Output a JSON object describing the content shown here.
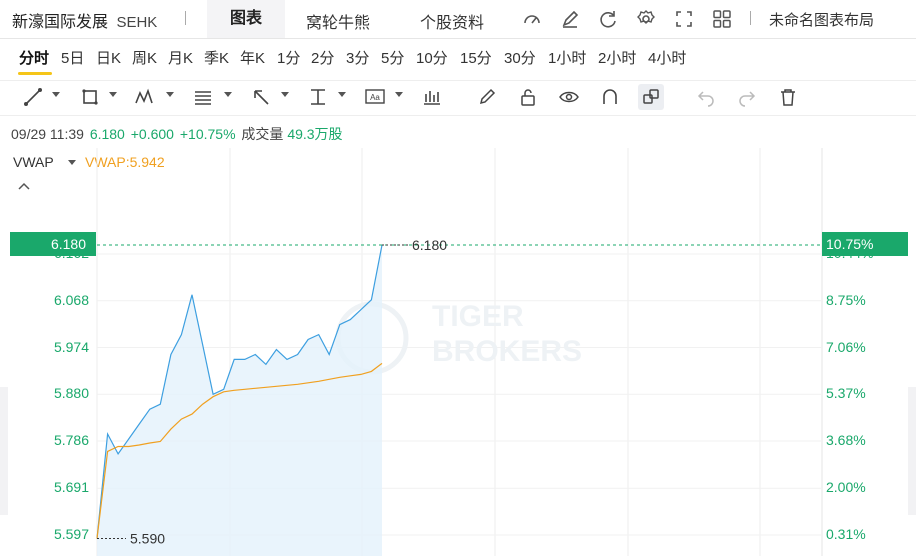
{
  "header": {
    "title": "新濠国际发展",
    "exchange": "SEHK",
    "tabs": [
      "图表",
      "窝轮牛熊",
      "个股资料"
    ],
    "active_tab": "图表",
    "layout_label": "未命名图表布局"
  },
  "periods": [
    "分时",
    "5日",
    "日K",
    "周K",
    "月K",
    "季K",
    "年K",
    "1分",
    "2分",
    "3分",
    "5分",
    "10分",
    "15分",
    "30分",
    "1小时",
    "2小时",
    "4小时"
  ],
  "active_period": "分时",
  "info": {
    "datetime": "09/29 11:39",
    "price": "6.180",
    "change": "+0.600",
    "change_pct": "+10.75%",
    "volume_label": "成交量",
    "volume": "49.3万股"
  },
  "legend": {
    "indicator": "VWAP",
    "value_text": "VWAP:5.942"
  },
  "watermark": [
    "TIGER",
    "BROKERS"
  ],
  "colors": {
    "price_line": "#3d9fe0",
    "vwap_line": "#f0a020",
    "up": "#1aa86b",
    "accent": "#f5c518"
  },
  "chart_data": {
    "type": "line",
    "title": "",
    "y_ticks": [
      "5.597",
      "5.691",
      "5.786",
      "5.880",
      "5.974",
      "6.068",
      "6.162"
    ],
    "y_pct_ticks": [
      "0.31%",
      "2.00%",
      "3.68%",
      "5.37%",
      "7.06%",
      "8.75%",
      "10.44%"
    ],
    "ylim": [
      5.585,
      6.214
    ],
    "current_price_label": "6.180",
    "current_pct_label": "10.75%",
    "high_annotation": "6.180",
    "low_annotation": "5.590",
    "series": [
      {
        "name": "VWAP",
        "values": [
          5.59,
          5.765,
          5.775,
          5.775,
          5.778,
          5.782,
          5.785,
          5.81,
          5.83,
          5.84,
          5.86,
          5.875,
          5.885,
          5.888,
          5.89,
          5.892,
          5.894,
          5.896,
          5.898,
          5.9,
          5.903,
          5.906,
          5.91,
          5.914,
          5.917,
          5.92,
          5.926,
          5.942
        ]
      },
      {
        "values": [
          5.59,
          5.8,
          5.76,
          5.79,
          5.82,
          5.85,
          5.86,
          5.96,
          6.0,
          6.08,
          5.98,
          5.88,
          5.89,
          5.95,
          5.95,
          5.96,
          5.94,
          5.97,
          5.95,
          5.96,
          5.99,
          6.0,
          5.96,
          6.02,
          6.03,
          6.05,
          6.07,
          6.18
        ]
      }
    ]
  }
}
